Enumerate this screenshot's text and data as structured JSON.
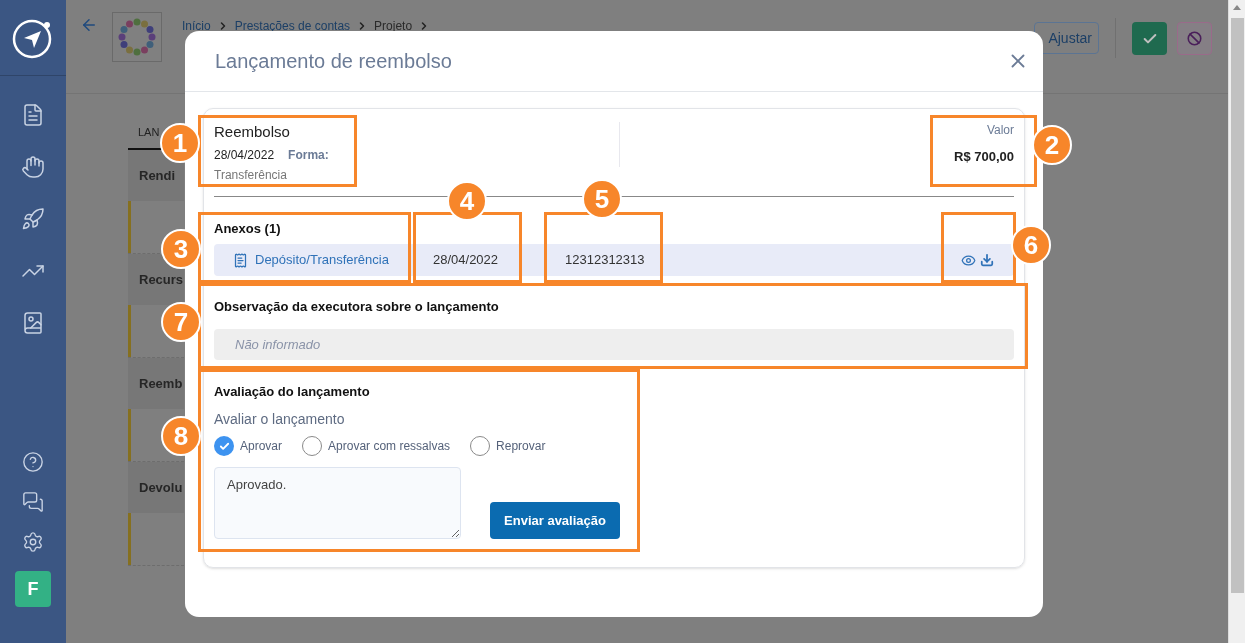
{
  "breadcrumb": [
    "Início",
    "Prestações de contas",
    "Projeto"
  ],
  "toolbar": {
    "adjust_button": "Ajustar"
  },
  "background_tab": "LAN",
  "background_sections": [
    "Rendi",
    "Recurs",
    "Reemb",
    "Devolu"
  ],
  "avatar": "F",
  "modal": {
    "title": "Lançamento de reembolso",
    "summary": {
      "type": "Reembolso",
      "date": "28/04/2022",
      "form_label": "Forma:",
      "form_value": "Transferência",
      "value_label": "Valor",
      "value": "R$ 700,00"
    },
    "attachments": {
      "heading": "Anexos (1)",
      "rows": [
        {
          "name": "Depósito/Transferência",
          "date": "28/04/2022",
          "number": "12312312313"
        }
      ]
    },
    "observation": {
      "heading": "Observação da executora sobre o lançamento",
      "placeholder": "Não informado"
    },
    "evaluation": {
      "heading": "Avaliação do lançamento",
      "label": "Avaliar o lançamento",
      "options": [
        {
          "label": "Aprovar",
          "selected": true
        },
        {
          "label": "Aprovar com ressalvas",
          "selected": false
        },
        {
          "label": "Reprovar",
          "selected": false
        }
      ],
      "comment": "Aprovado.",
      "submit": "Enviar avaliação"
    }
  },
  "annotations": [
    "1",
    "2",
    "3",
    "4",
    "5",
    "6",
    "7",
    "8"
  ]
}
